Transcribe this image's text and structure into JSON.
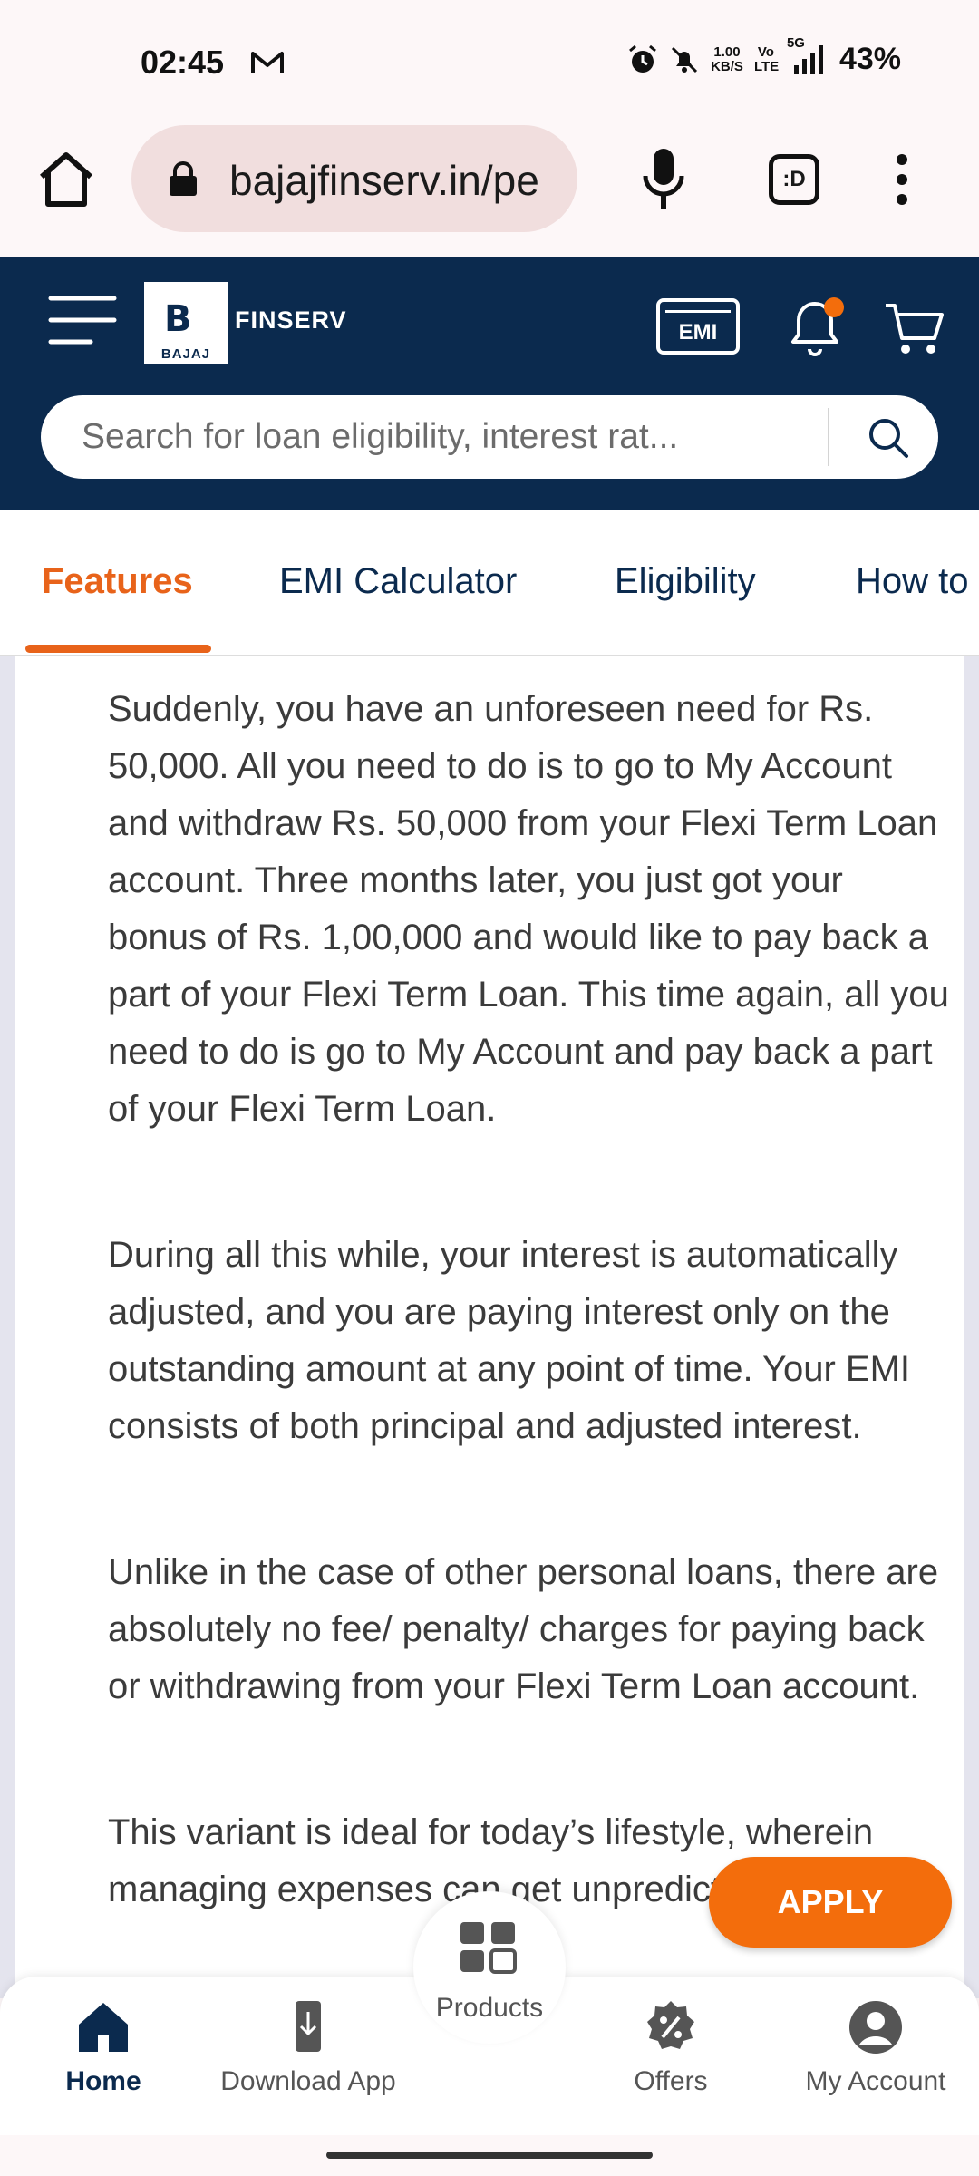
{
  "status_bar": {
    "time": "02:45",
    "network_speed_value": "1.00",
    "network_speed_unit": "KB/S",
    "volte_label": "Vo LTE",
    "signal_label": "5G",
    "battery": "43%",
    "icons": [
      "gmail-icon",
      "alarm-icon",
      "mute-icon",
      "signal-icon"
    ]
  },
  "browser": {
    "url": "bajajfinserv.in/pe",
    "tab_switcher_label": ":D",
    "icons": [
      "home-icon",
      "lock-icon",
      "mic-icon",
      "more-vert-icon"
    ]
  },
  "site_header": {
    "logo_word": "BAJAJ",
    "brand_word": "FINSERV",
    "emi_label": "EMI",
    "search_placeholder": "Search for loan eligibility, interest rat...",
    "notification_dot_color": "#f36d0c",
    "background_color": "#0b2a4e"
  },
  "tabs": [
    {
      "label": "Features",
      "active": true
    },
    {
      "label": "EMI Calculator",
      "active": false
    },
    {
      "label": "Eligibility",
      "active": false
    },
    {
      "label": "How to",
      "active": false
    }
  ],
  "content": {
    "paragraphs": [
      "Suddenly, you have an unforeseen need for Rs. 50,000. All you need to do is to go to My Account and withdraw Rs. 50,000 from your Flexi Term Loan account. Three months later, you just got your bonus of Rs. 1,00,000 and would like to pay back a part of your Flexi Term Loan. This time again, all you need to do is go to My Account and pay back a part of your Flexi Term Loan.",
      "During all this while, your interest is automatically adjusted, and you are paying interest only on the outstanding amount at any point of time. Your EMI consists of both principal and adjusted interest.",
      "Unlike in the case of other personal loans, there are absolutely no fee/ penalty/ charges for paying back or withdrawing from your Flexi Term Loan account.",
      "This variant is ideal for today’s lifestyle, wherein managing expenses can get unpredictable."
    ]
  },
  "apply_label": "APPLY",
  "accent_color": "#f36d0c",
  "bottom_nav": {
    "items": [
      {
        "label": "Home",
        "icon": "home-icon",
        "active": true
      },
      {
        "label": "Download App",
        "icon": "download-app-icon",
        "active": false
      },
      {
        "label": "Products",
        "icon": "grid-icon",
        "active": false
      },
      {
        "label": "Offers",
        "icon": "offers-icon",
        "active": false
      },
      {
        "label": "My Account",
        "icon": "account-icon",
        "active": false
      }
    ]
  }
}
